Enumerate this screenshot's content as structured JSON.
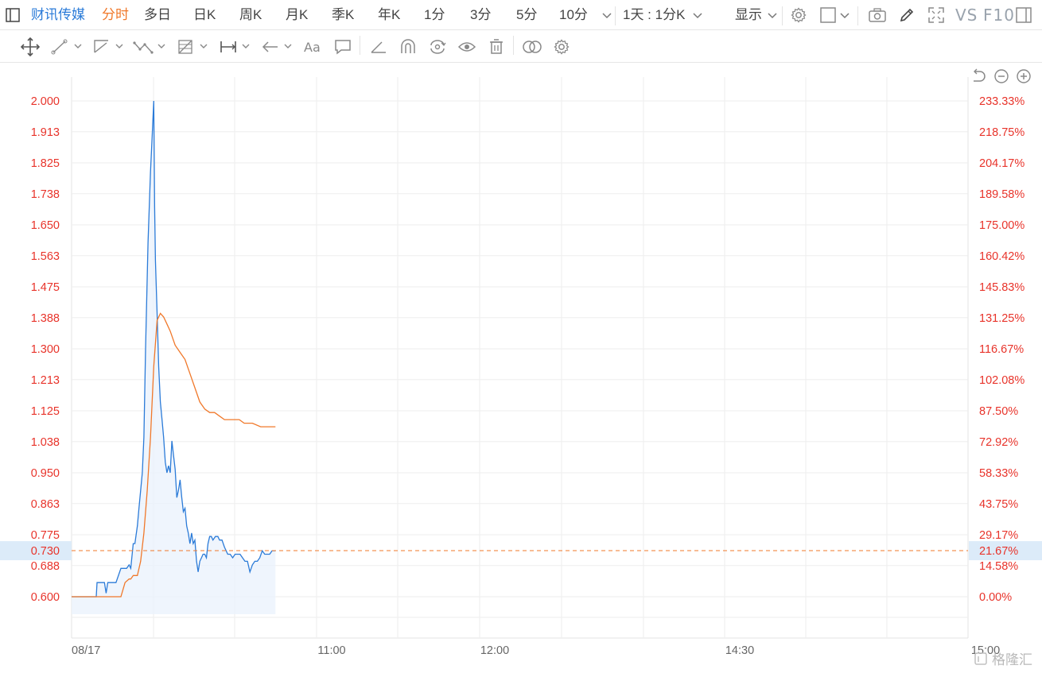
{
  "header": {
    "stock_name": "财讯传媒",
    "tabs": [
      "分时",
      "多日",
      "日K",
      "周K",
      "月K",
      "季K",
      "年K",
      "1分",
      "3分",
      "5分",
      "10分"
    ],
    "active_tab": "分时",
    "period_select": "1天 : 1分K",
    "display_label": "显示",
    "vs_label": "VS",
    "f10_label": "F10"
  },
  "watermark": "格隆汇",
  "colors": {
    "price_line": "#2b7bd8",
    "avg_line": "#f0782a",
    "axis_text": "#e8332a",
    "grid": "#eeeeee",
    "fill": "#eaf2fc"
  },
  "chart_data": {
    "type": "line",
    "title": "",
    "xlabel": "",
    "ylabel": "",
    "x_tick_labels": [
      "08/17",
      "11:00",
      "12:00",
      "14:30",
      "15:00"
    ],
    "y_ticks": [
      2.0,
      1.913,
      1.825,
      1.738,
      1.65,
      1.563,
      1.475,
      1.388,
      1.3,
      1.213,
      1.125,
      1.038,
      0.95,
      0.863,
      0.775,
      0.688,
      0.6
    ],
    "y_tick_labels": [
      "2.000",
      "1.913",
      "1.825",
      "1.738",
      "1.650",
      "1.563",
      "1.475",
      "1.388",
      "1.300",
      "1.213",
      "1.125",
      "1.038",
      "0.950",
      "0.863",
      "0.775",
      "0.688",
      "0.600"
    ],
    "pct_tick_labels": [
      "233.33%",
      "218.75%",
      "204.17%",
      "189.58%",
      "175.00%",
      "160.42%",
      "145.83%",
      "131.25%",
      "116.67%",
      "102.08%",
      "87.50%",
      "72.92%",
      "58.33%",
      "43.75%",
      "29.17%",
      "14.58%",
      "0.00%"
    ],
    "ylim": [
      0.6,
      2.0
    ],
    "prev_close": 0.6,
    "current_price": 0.73,
    "current_price_label": "0.730",
    "current_pct_label": "21.67%",
    "grid": true,
    "series": [
      {
        "key": "price",
        "x": [
          0,
          30,
          31,
          33,
          40,
          42,
          44,
          46,
          50,
          54,
          60,
          62,
          65,
          67,
          70,
          72,
          75,
          77,
          80,
          82,
          84,
          86,
          88,
          90,
          93,
          96,
          98,
          100,
          101,
          102,
          104,
          106,
          108,
          110,
          112,
          114,
          116,
          118,
          120,
          122,
          124,
          126,
          128,
          130,
          132,
          134,
          136,
          138,
          140,
          142,
          144,
          146,
          148,
          150,
          152,
          154,
          156,
          158,
          160,
          162,
          164,
          166,
          168,
          170,
          172,
          175,
          178,
          180,
          183,
          186,
          188,
          190,
          193,
          196,
          199,
          202,
          205,
          208,
          211,
          214,
          217,
          220,
          223,
          226,
          229,
          232,
          235,
          238,
          241,
          244,
          247,
          248
        ],
        "y": [
          0.6,
          0.6,
          0.64,
          0.64,
          0.64,
          0.61,
          0.64,
          0.64,
          0.64,
          0.64,
          0.68,
          0.68,
          0.68,
          0.68,
          0.69,
          0.68,
          0.75,
          0.75,
          0.8,
          0.85,
          0.9,
          0.95,
          1.05,
          1.3,
          1.6,
          1.8,
          1.9,
          2.0,
          1.7,
          1.55,
          1.4,
          1.25,
          1.15,
          1.1,
          1.05,
          0.98,
          0.95,
          0.97,
          0.95,
          1.04,
          1.0,
          0.96,
          0.88,
          0.9,
          0.93,
          0.88,
          0.84,
          0.85,
          0.8,
          0.78,
          0.75,
          0.78,
          0.75,
          0.76,
          0.7,
          0.67,
          0.7,
          0.71,
          0.72,
          0.72,
          0.71,
          0.75,
          0.77,
          0.77,
          0.76,
          0.77,
          0.77,
          0.76,
          0.76,
          0.74,
          0.73,
          0.72,
          0.72,
          0.71,
          0.72,
          0.72,
          0.72,
          0.71,
          0.7,
          0.7,
          0.67,
          0.69,
          0.7,
          0.7,
          0.71,
          0.73,
          0.72,
          0.72,
          0.72,
          0.73,
          0.73,
          0.73
        ]
      },
      {
        "key": "avg",
        "x": [
          0,
          60,
          65,
          70,
          72,
          75,
          78,
          80,
          84,
          88,
          92,
          96,
          100,
          104,
          108,
          112,
          116,
          120,
          126,
          132,
          138,
          144,
          150,
          156,
          162,
          168,
          174,
          180,
          186,
          192,
          198,
          204,
          210,
          220,
          230,
          240,
          248
        ],
        "y": [
          0.6,
          0.6,
          0.64,
          0.65,
          0.65,
          0.66,
          0.66,
          0.66,
          0.7,
          0.78,
          0.9,
          1.05,
          1.25,
          1.38,
          1.4,
          1.39,
          1.37,
          1.35,
          1.31,
          1.29,
          1.27,
          1.23,
          1.19,
          1.15,
          1.13,
          1.12,
          1.12,
          1.11,
          1.1,
          1.1,
          1.1,
          1.1,
          1.09,
          1.09,
          1.08,
          1.08,
          1.08
        ]
      }
    ],
    "x_domain": [
      0,
      240
    ]
  }
}
